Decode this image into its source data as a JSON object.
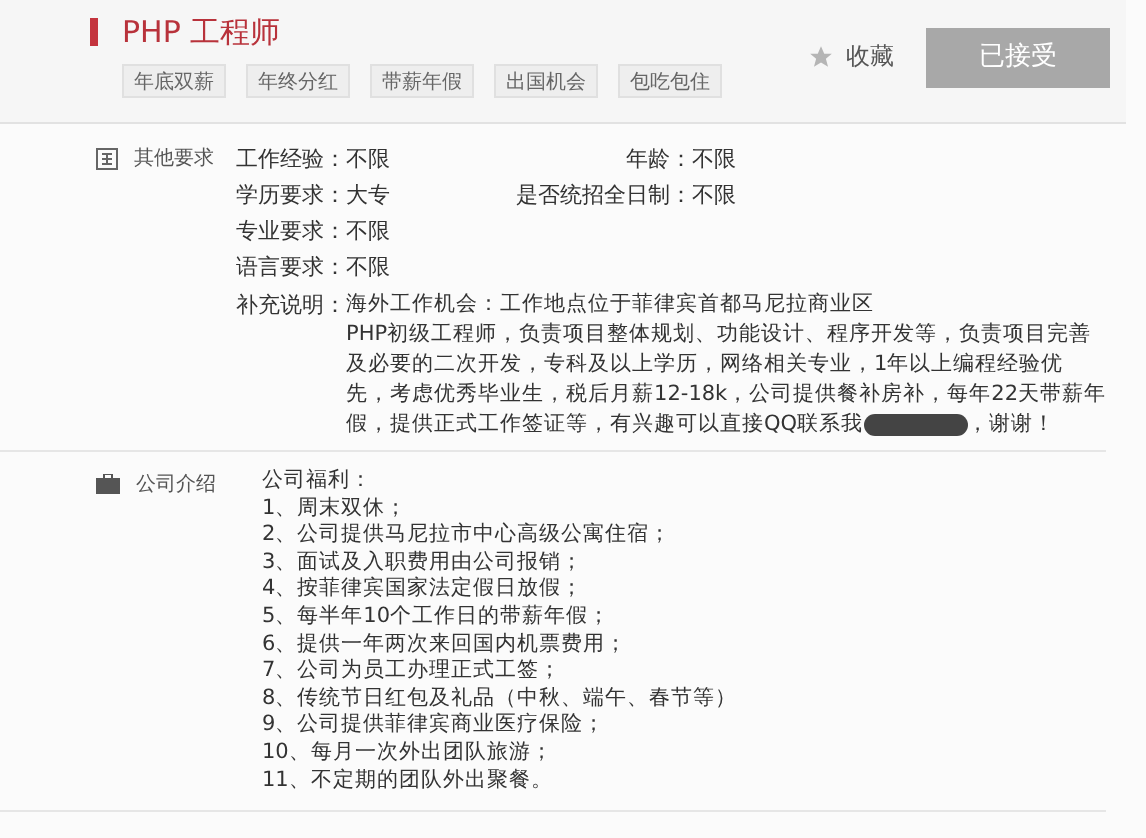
{
  "job": {
    "title": "PHP 工程师",
    "tags": [
      "年底双薪",
      "年终分红",
      "带薪年假",
      "出国机会",
      "包吃包住"
    ],
    "favorite": {
      "label": "收藏",
      "selected": false
    },
    "status_button": {
      "label": "已接受",
      "disabled": true
    }
  },
  "requirements": {
    "heading": "其他要求",
    "rows": [
      [
        {
          "label": "工作经验：",
          "value": "不限"
        },
        {
          "label": "年龄：",
          "value": "不限"
        }
      ],
      [
        {
          "label": "学历要求：",
          "value": "大专"
        },
        {
          "label": "是否统招全日制：",
          "value": "不限"
        }
      ],
      [
        {
          "label": "专业要求：",
          "value": "不限"
        }
      ],
      [
        {
          "label": "语言要求：",
          "value": "不限"
        }
      ]
    ],
    "supplement": {
      "label": "补充说明：",
      "lines": [
        "海外工作机会：工作地点位于菲律宾首都马尼拉商业区",
        "PHP初级工程师，负责项目整体规划、功能设计、程序开发等，负责项目完善",
        "及必要的二次开发，专科及以上学历，网络相关专业，1年以上编程经验优",
        "先，考虑优秀毕业生，税后月薪12-18k，公司提供餐补房补，每年22天带薪年"
      ],
      "last_line_before": "假，提供正式工作签证等，有兴趣可以直接QQ联系我",
      "redacted": true,
      "last_line_after": "，谢谢！"
    }
  },
  "company": {
    "heading": "公司介绍",
    "lines": [
      "公司福利：",
      "1、周末双休；",
      "2、公司提供马尼拉市中心高级公寓住宿；",
      "3、面试及入职费用由公司报销；",
      "4、按菲律宾国家法定假日放假；",
      "5、每半年10个工作日的带薪年假；",
      "6、提供一年两次来回国内机票费用；",
      "7、公司为员工办理正式工签；",
      "8、传统节日红包及礼品（中秋、端午、春节等）",
      "9、公司提供菲律宾商业医疗保险；",
      "10、每月一次外出团队旅游；",
      "11、不定期的团队外出聚餐。"
    ]
  }
}
